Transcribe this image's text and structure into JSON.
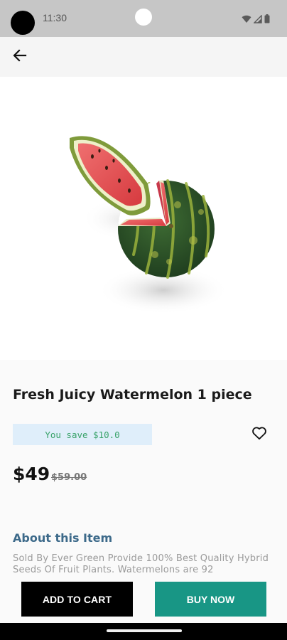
{
  "status_bar": {
    "time": "11:30",
    "icons": [
      "wifi-icon",
      "signal-icon",
      "battery-icon"
    ]
  },
  "app_bar": {
    "back_icon": "arrow-left-icon"
  },
  "product": {
    "image_icon": "watermelon-image",
    "title": "Fresh Juicy Watermelon 1 piece",
    "savings": "You save $10.0",
    "price": "$49",
    "old_price": "$59.00",
    "wishlist_icon": "heart-outline-icon"
  },
  "about": {
    "heading": "About this Item",
    "description": "Sold By Ever Green Provide 100% Best Quality Hybrid Seeds Of Fruit Plants. Watermelons are 92"
  },
  "actions": {
    "add_to_cart": "ADD TO CART",
    "buy_now": "BUY NOW"
  },
  "colors": {
    "buy_now": "#189685",
    "add_to_cart": "#000000",
    "savings_badge_bg": "#dfeefa",
    "savings_text": "#3aa36a",
    "about_heading": "#3d6a8a"
  }
}
